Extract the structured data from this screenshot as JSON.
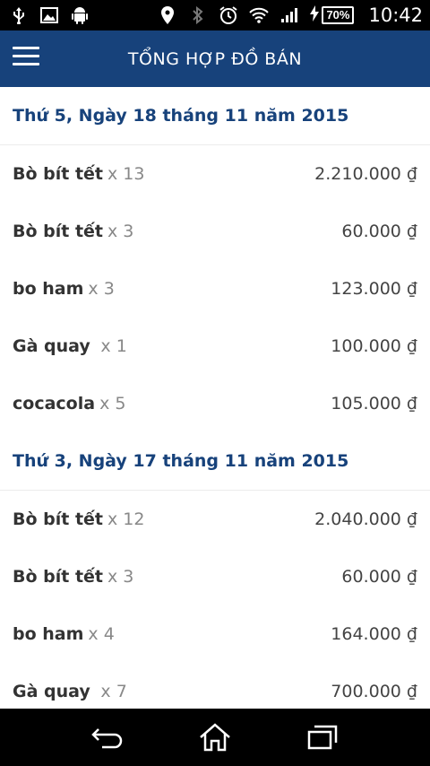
{
  "status_bar": {
    "battery": "70%",
    "time": "10:42",
    "icons": [
      "usb-icon",
      "image-icon",
      "android-icon",
      "location-icon",
      "bluetooth-icon",
      "alarm-icon",
      "wifi-icon",
      "signal-icon",
      "charging-icon"
    ]
  },
  "app_bar": {
    "title": "TỔNG HỢP ĐỒ BÁN"
  },
  "groups": [
    {
      "date": "Thứ 5, Ngày 18 tháng 11 năm 2015",
      "items": [
        {
          "name": "Bò bít tết",
          "qty": "x 13",
          "price": "2.210.000 ₫"
        },
        {
          "name": "Bò bít tết",
          "qty": "x 3",
          "price": "60.000 ₫"
        },
        {
          "name": "bo ham",
          "qty": "x 3",
          "price": "123.000 ₫"
        },
        {
          "name": "Gà quay ",
          "qty": "x 1",
          "price": "100.000 ₫"
        },
        {
          "name": "cocacola",
          "qty": "x 5",
          "price": "105.000 ₫"
        }
      ]
    },
    {
      "date": "Thứ 3, Ngày 17 tháng 11 năm 2015",
      "items": [
        {
          "name": "Bò bít tết",
          "qty": "x 12",
          "price": "2.040.000 ₫"
        },
        {
          "name": "Bò bít tết",
          "qty": "x 3",
          "price": "60.000 ₫"
        },
        {
          "name": "bo ham",
          "qty": "x 4",
          "price": "164.000 ₫"
        },
        {
          "name": "Gà quay ",
          "qty": "x 7",
          "price": "700.000 ₫"
        }
      ]
    }
  ],
  "nav_bar": {
    "icons": [
      "back-icon",
      "home-icon",
      "recents-icon"
    ]
  }
}
